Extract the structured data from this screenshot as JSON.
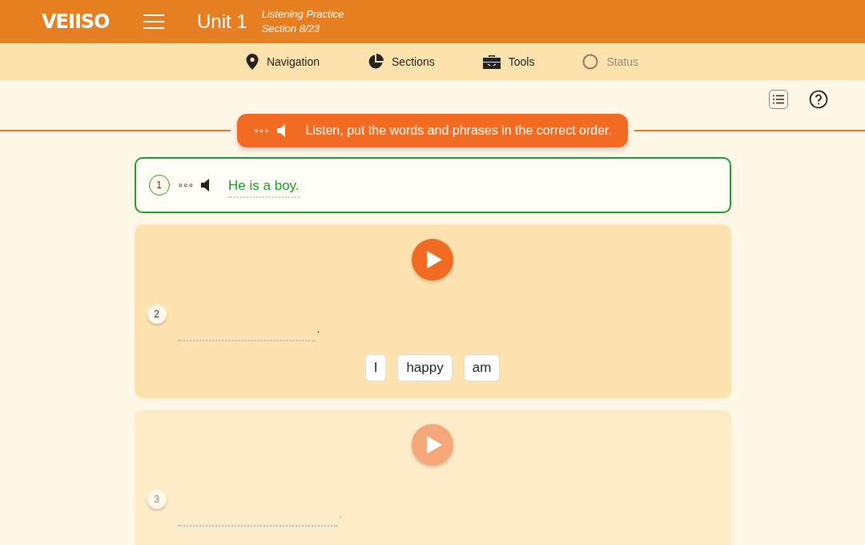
{
  "header": {
    "logo": "VEIISO",
    "title": "Unit 1",
    "subtitle_lines": [
      "Listening Practice",
      "Section 8/23"
    ]
  },
  "nav": [
    {
      "label": "Navigation",
      "kind": "navigation",
      "disabled": false
    },
    {
      "label": "Sections",
      "kind": "sections",
      "disabled": false
    },
    {
      "label": "Tools",
      "kind": "tools",
      "disabled": false
    },
    {
      "label": "Status",
      "kind": "status",
      "disabled": true
    }
  ],
  "instruction": {
    "dots": "∘∘∘",
    "text": "Listen, put the words and phrases in the correct order."
  },
  "items": [
    {
      "number": "1",
      "kind": "answered",
      "correct": true,
      "dots": "∘∘∘",
      "answer": "He is a boy."
    },
    {
      "number": "2",
      "kind": "question",
      "active": true,
      "end_mark": ".",
      "chips": [
        "I",
        "happy",
        "am"
      ]
    },
    {
      "number": "3",
      "kind": "question",
      "active": false,
      "end_mark": "."
    }
  ]
}
